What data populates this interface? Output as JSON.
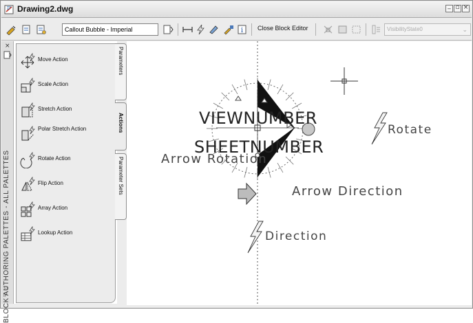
{
  "window": {
    "title": "Drawing2.dwg",
    "controls": [
      "minimize",
      "restore",
      "close"
    ]
  },
  "toolbar": {
    "block_name": "Callout Bubble - Imperial",
    "close_label": "Close Block Editor",
    "visibility_state": "VisibilityState0"
  },
  "palette": {
    "title": "BLOCK AUTHORING PALETTES - ALL PALETTES",
    "tabs": [
      "Parameters",
      "Actions",
      "Parameter Sets"
    ],
    "active_tab": "Actions",
    "items": [
      {
        "label": "Move Action",
        "icon": "move-action-icon"
      },
      {
        "label": "Scale Action",
        "icon": "scale-action-icon"
      },
      {
        "label": "Stretch Action",
        "icon": "stretch-action-icon"
      },
      {
        "label": "Polar Stretch Action",
        "icon": "polar-stretch-action-icon"
      },
      {
        "label": "Rotate Action",
        "icon": "rotate-action-icon"
      },
      {
        "label": "Flip Action",
        "icon": "flip-action-icon"
      },
      {
        "label": "Array Action",
        "icon": "array-action-icon"
      },
      {
        "label": "Lookup Action",
        "icon": "lookup-action-icon"
      }
    ]
  },
  "drawing": {
    "viewnumber": "VIEWNUMBER",
    "sheetnumber": "SHEETNUMBER",
    "arrow_rotation": "Arrow Rotation",
    "arrow_direction": "Arrow Direction",
    "rotate": "Rotate",
    "direction": "Direction"
  }
}
